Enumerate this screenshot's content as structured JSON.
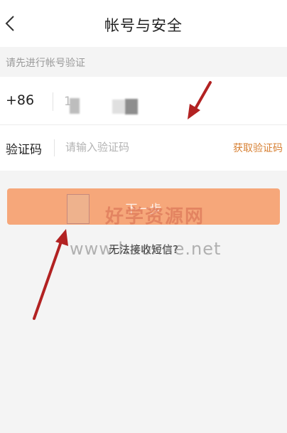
{
  "header": {
    "title": "帐号与安全"
  },
  "verify_hint": "请先进行帐号验证",
  "phone": {
    "country_code": "+86",
    "number_visible": "1"
  },
  "code": {
    "label": "验证码",
    "placeholder": "请输入验证码",
    "get_code_label": "获取验证码"
  },
  "next_button": {
    "label": "下一步"
  },
  "cannot_receive": "无法接收短信?",
  "watermark": {
    "chinese": "好学资源网",
    "url": "www.haoxue.net"
  },
  "colors": {
    "accent_orange": "#d78033",
    "button_bg": "#f6a77a",
    "arrow_red": "#b22222"
  },
  "icons": [
    "back-chevron-icon",
    "red-arrow-annotation"
  ]
}
